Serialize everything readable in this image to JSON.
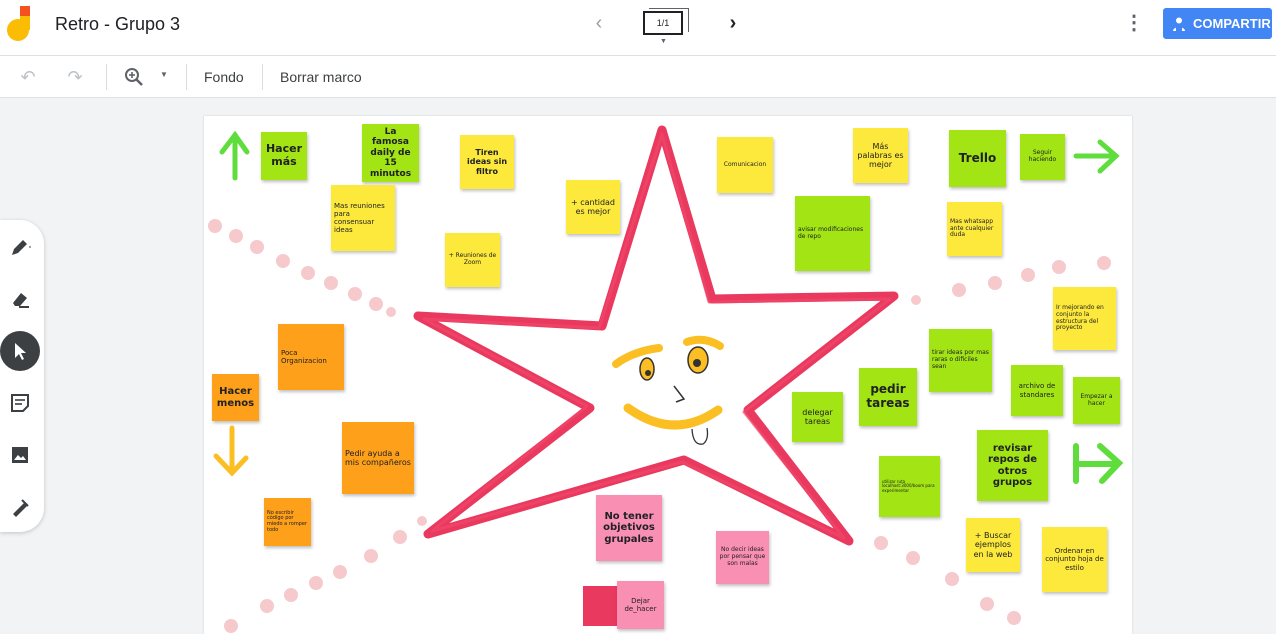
{
  "app": {
    "title": "Retro - Grupo 3",
    "frame_indicator": "1/1",
    "share_label": "COMPARTIR",
    "accent_color": "#4285f4"
  },
  "toolbar": {
    "background_label": "Fondo",
    "clear_frame_label": "Borrar marco"
  },
  "tools": [
    "pen-icon",
    "eraser-icon",
    "select-arrow-icon",
    "sticky-note-icon",
    "image-icon",
    "laser-icon"
  ],
  "canvas": {
    "notes": [
      {
        "text": "Hacer más",
        "color": "green"
      },
      {
        "text": "La famosa daily de 15 minutos",
        "color": "green"
      },
      {
        "text": "Tiren ideas sin filtro",
        "color": "yellow"
      },
      {
        "text": "Mas reuniones para consensuar ideas",
        "color": "yellow"
      },
      {
        "text": "+ cantidad es mejor",
        "color": "yellow"
      },
      {
        "text": "+ Reuniones de Zoom",
        "color": "yellow"
      },
      {
        "text": "Comunicacion",
        "color": "yellow"
      },
      {
        "text": "Más palabras es mejor",
        "color": "yellow"
      },
      {
        "text": "Trello",
        "color": "green"
      },
      {
        "text": "Seguir haciendo",
        "color": "green"
      },
      {
        "text": "avisar modificaciones de repo",
        "color": "green"
      },
      {
        "text": "Mas whatsapp ante cualquier duda",
        "color": "yellow"
      },
      {
        "text": "Poca Organizacion",
        "color": "orange"
      },
      {
        "text": "Hacer menos",
        "color": "orange"
      },
      {
        "text": "Pedir ayuda a mis compañeros",
        "color": "orange"
      },
      {
        "text": "No escribir código por miedo a romper todo",
        "color": "orange"
      },
      {
        "text": "Ir mejorando en conjunto la estructura del proyecto",
        "color": "yellow"
      },
      {
        "text": "tirar ideas por mas raras o dificiles sean",
        "color": "green"
      },
      {
        "text": "pedir tareas",
        "color": "green"
      },
      {
        "text": "delegar tareas",
        "color": "green"
      },
      {
        "text": "archivo de standares",
        "color": "green"
      },
      {
        "text": "Empezar a hacer",
        "color": "green"
      },
      {
        "text": "revisar repos de otros grupos",
        "color": "green"
      },
      {
        "text": "utilizar ruta localhost:3000/boom para experimentar",
        "color": "green"
      },
      {
        "text": "No tener objetivos grupales",
        "color": "pink"
      },
      {
        "text": "No decir ideas por pensar que son malas",
        "color": "pink"
      },
      {
        "text": "Dejar de_hacer",
        "color": "pink"
      },
      {
        "text": "+ Buscar ejemplos en la web",
        "color": "yellow"
      },
      {
        "text": "Ordenar en conjunto hoja de estilo",
        "color": "yellow"
      }
    ]
  }
}
